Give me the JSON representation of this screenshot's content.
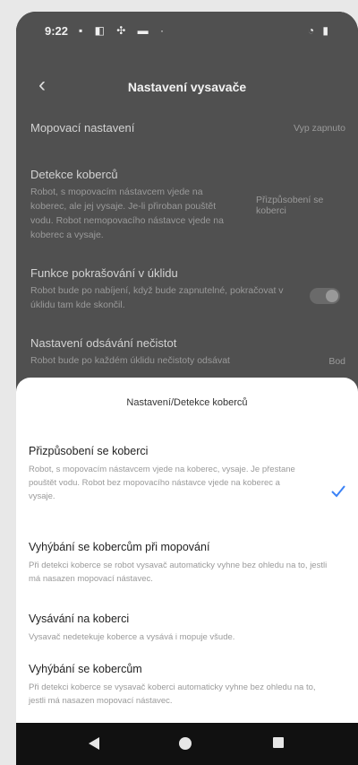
{
  "status_bar": {
    "time": "9:22",
    "left_icons": "▪ ◧ ✣ ▬ ·",
    "right_icons": "◔ ▮"
  },
  "header": {
    "title": "Nastavení vysavače"
  },
  "settings": [
    {
      "label": "Mopovací nastavení",
      "value": "Vyp zapnuto",
      "desc": ""
    },
    {
      "label": "Detekce koberců",
      "value": "Přizpůsobení se koberci",
      "desc": "Robot, s mopovacím nástavcem vjede na koberec, ale jej vysaje. Je-li přiroban pouštět vodu. Robot nemopovacího nástavce vjede na koberec a vysaje."
    },
    {
      "label": "Funkce pokrašování v úklidu",
      "value": "",
      "desc": "Robot bude po nabíjení, když bude zapnutelné, pokračovat v úklidu tam kde skončil."
    },
    {
      "label": "Nastavení odsávání nečistot",
      "value": "Bod",
      "desc": "Robot bude po každém úklidu nečistoty odsávat"
    }
  ],
  "sheet": {
    "title": "Nastavení/Detekce koberců",
    "options": [
      {
        "label": "Přizpůsobení se koberci",
        "desc": "Robot, s mopovacím nástavcem vjede na koberec, vysaje. Je přestane pouštět vodu. Robot bez mopovacího nástavce vjede na koberec a vysaje.",
        "selected": true
      },
      {
        "label": "Vyhýbání se kobercům při mopování",
        "desc": "Při detekci koberce se robot vysavač automaticky vyhne bez ohledu na to, jestli má nasazen mopovací nástavec.",
        "selected": false
      },
      {
        "label": "Vysávání na koberci",
        "desc": "Vysavač nedetekuje koberce a vysává i mopuje všude.",
        "selected": false
      },
      {
        "label": "Vyhýbání se kobercům",
        "desc": "Při detekci koberce se vysavač koberci automaticky vyhne bez ohledu na to, jestli má nasazen mopovací nástavec.",
        "selected": false
      }
    ]
  },
  "icons": {
    "back": "chevron-left-icon",
    "check": "check-icon",
    "nav_back": "triangle-back-icon",
    "nav_home": "circle-home-icon",
    "nav_recents": "square-recents-icon"
  },
  "colors": {
    "accent": "#3b82f6",
    "overlay": "#505050",
    "sheet_bg": "#ffffff"
  }
}
